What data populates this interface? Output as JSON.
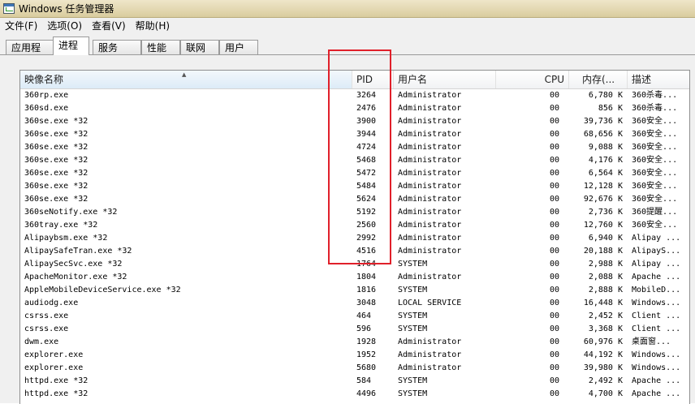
{
  "window": {
    "title": "Windows 任务管理器"
  },
  "menu": [
    {
      "id": "file",
      "label": "文件(F)"
    },
    {
      "id": "options",
      "label": "选项(O)"
    },
    {
      "id": "view",
      "label": "查看(V)"
    },
    {
      "id": "help",
      "label": "帮助(H)"
    }
  ],
  "tabs": [
    {
      "id": "applications",
      "label": "应用程序"
    },
    {
      "id": "processes",
      "label": "进程",
      "active": true
    },
    {
      "id": "services",
      "label": "服务"
    },
    {
      "id": "performance",
      "label": "性能"
    },
    {
      "id": "networking",
      "label": "联网"
    },
    {
      "id": "users",
      "label": "用户"
    }
  ],
  "columns": {
    "name": "映像名称",
    "pid": "PID",
    "user": "用户名",
    "cpu": "CPU",
    "mem": "内存(...",
    "desc": "描述"
  },
  "processes": [
    {
      "name": "360rp.exe",
      "pid": "3264",
      "user": "Administrator",
      "cpu": "00",
      "mem": "6,780 K",
      "desc": "360杀毒..."
    },
    {
      "name": "360sd.exe",
      "pid": "2476",
      "user": "Administrator",
      "cpu": "00",
      "mem": "856 K",
      "desc": "360杀毒..."
    },
    {
      "name": "360se.exe *32",
      "pid": "3900",
      "user": "Administrator",
      "cpu": "00",
      "mem": "39,736 K",
      "desc": "360安全..."
    },
    {
      "name": "360se.exe *32",
      "pid": "3944",
      "user": "Administrator",
      "cpu": "00",
      "mem": "68,656 K",
      "desc": "360安全..."
    },
    {
      "name": "360se.exe *32",
      "pid": "4724",
      "user": "Administrator",
      "cpu": "00",
      "mem": "9,088 K",
      "desc": "360安全..."
    },
    {
      "name": "360se.exe *32",
      "pid": "5468",
      "user": "Administrator",
      "cpu": "00",
      "mem": "4,176 K",
      "desc": "360安全..."
    },
    {
      "name": "360se.exe *32",
      "pid": "5472",
      "user": "Administrator",
      "cpu": "00",
      "mem": "6,564 K",
      "desc": "360安全..."
    },
    {
      "name": "360se.exe *32",
      "pid": "5484",
      "user": "Administrator",
      "cpu": "00",
      "mem": "12,128 K",
      "desc": "360安全..."
    },
    {
      "name": "360se.exe *32",
      "pid": "5624",
      "user": "Administrator",
      "cpu": "00",
      "mem": "92,676 K",
      "desc": "360安全..."
    },
    {
      "name": "360seNotify.exe *32",
      "pid": "5192",
      "user": "Administrator",
      "cpu": "00",
      "mem": "2,736 K",
      "desc": "360提醒..."
    },
    {
      "name": "360tray.exe *32",
      "pid": "2560",
      "user": "Administrator",
      "cpu": "00",
      "mem": "12,760 K",
      "desc": "360安全..."
    },
    {
      "name": "Alipaybsm.exe *32",
      "pid": "2992",
      "user": "Administrator",
      "cpu": "00",
      "mem": "6,940 K",
      "desc": "Alipay ..."
    },
    {
      "name": "AlipaySafeTran.exe *32",
      "pid": "4516",
      "user": "Administrator",
      "cpu": "00",
      "mem": "20,188 K",
      "desc": "AlipayS..."
    },
    {
      "name": "AlipaySecSvc.exe *32",
      "pid": "1764",
      "user": "SYSTEM",
      "cpu": "00",
      "mem": "2,988 K",
      "desc": "Alipay ..."
    },
    {
      "name": "ApacheMonitor.exe *32",
      "pid": "1804",
      "user": "Administrator",
      "cpu": "00",
      "mem": "2,088 K",
      "desc": "Apache ..."
    },
    {
      "name": "AppleMobileDeviceService.exe *32",
      "pid": "1816",
      "user": "SYSTEM",
      "cpu": "00",
      "mem": "2,888 K",
      "desc": "MobileD..."
    },
    {
      "name": "audiodg.exe",
      "pid": "3048",
      "user": "LOCAL SERVICE",
      "cpu": "00",
      "mem": "16,448 K",
      "desc": "Windows..."
    },
    {
      "name": "csrss.exe",
      "pid": "464",
      "user": "SYSTEM",
      "cpu": "00",
      "mem": "2,452 K",
      "desc": "Client ..."
    },
    {
      "name": "csrss.exe",
      "pid": "596",
      "user": "SYSTEM",
      "cpu": "00",
      "mem": "3,368 K",
      "desc": "Client ..."
    },
    {
      "name": "dwm.exe",
      "pid": "1928",
      "user": "Administrator",
      "cpu": "00",
      "mem": "60,976 K",
      "desc": "桌面窗..."
    },
    {
      "name": "explorer.exe",
      "pid": "1952",
      "user": "Administrator",
      "cpu": "00",
      "mem": "44,192 K",
      "desc": "Windows..."
    },
    {
      "name": "explorer.exe",
      "pid": "5680",
      "user": "Administrator",
      "cpu": "00",
      "mem": "39,980 K",
      "desc": "Windows..."
    },
    {
      "name": "httpd.exe *32",
      "pid": "584",
      "user": "SYSTEM",
      "cpu": "00",
      "mem": "2,492 K",
      "desc": "Apache ..."
    },
    {
      "name": "httpd.exe *32",
      "pid": "4496",
      "user": "SYSTEM",
      "cpu": "00",
      "mem": "4,700 K",
      "desc": "Apache ..."
    }
  ],
  "colors": {
    "highlight": "#e0202a",
    "titlebar": "#d9cc9e"
  }
}
